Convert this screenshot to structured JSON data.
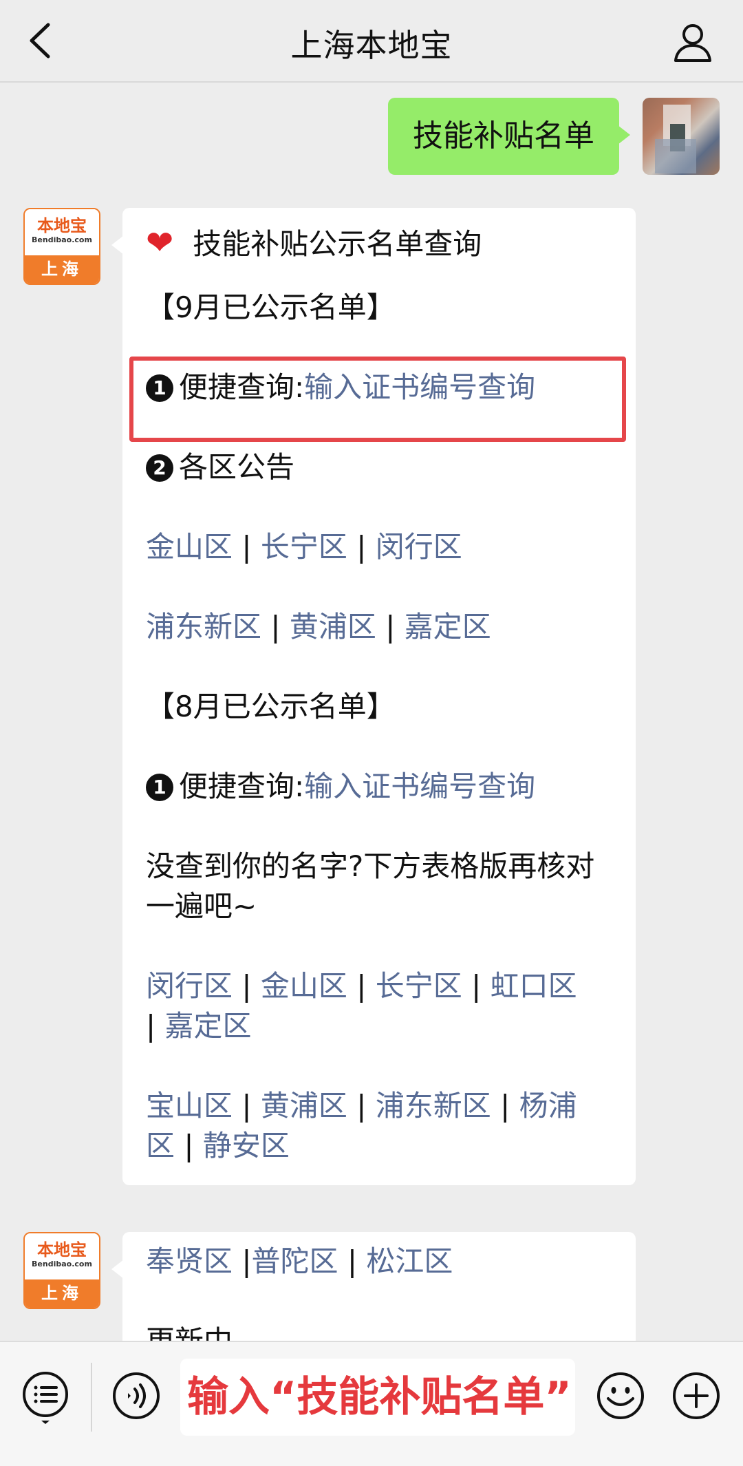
{
  "header": {
    "title": "上海本地宝"
  },
  "outgoing": {
    "text": "技能补贴名单"
  },
  "brand_avatar": {
    "name": "本地宝",
    "domain": "Bendibao.com",
    "city": "上海"
  },
  "message1": {
    "title": "技能补贴公示名单查询",
    "sept_header": "【9月已公示名单】",
    "quick_label": "便捷查询:",
    "quick_link": "输入证书编号查询",
    "district_label": "各区公告",
    "sept_row1": [
      "金山区",
      "长宁区",
      "闵行区"
    ],
    "sept_row2": [
      "浦东新区",
      "黄浦区",
      "嘉定区"
    ],
    "aug_header": "【8月已公示名单】",
    "aug_quick_label": "便捷查询:",
    "aug_quick_link": "输入证书编号查询",
    "note": "没查到你的名字?下方表格版再核对一遍吧~",
    "aug_row1": [
      "闵行区",
      "金山区",
      "长宁区",
      "虹口区"
    ],
    "aug_row1_tail": "嘉定区",
    "aug_row2": [
      "宝山区",
      "黄浦区",
      "浦东新区",
      "杨浦"
    ],
    "aug_row2_tail_part": "区",
    "aug_row2_tail": "静安区"
  },
  "message2": {
    "links": [
      "奉贤区",
      "普陀区",
      "松江区"
    ],
    "partial": "更新中"
  },
  "input": {
    "value": "输入“技能补贴名单”"
  },
  "colors": {
    "link": "#576b95",
    "bubble_out": "#95ec69",
    "highlight": "#e5464a"
  },
  "icons": [
    "back-icon",
    "profile-icon",
    "menu-icon",
    "voice-icon",
    "emoji-icon",
    "plus-icon",
    "heart-icon"
  ]
}
